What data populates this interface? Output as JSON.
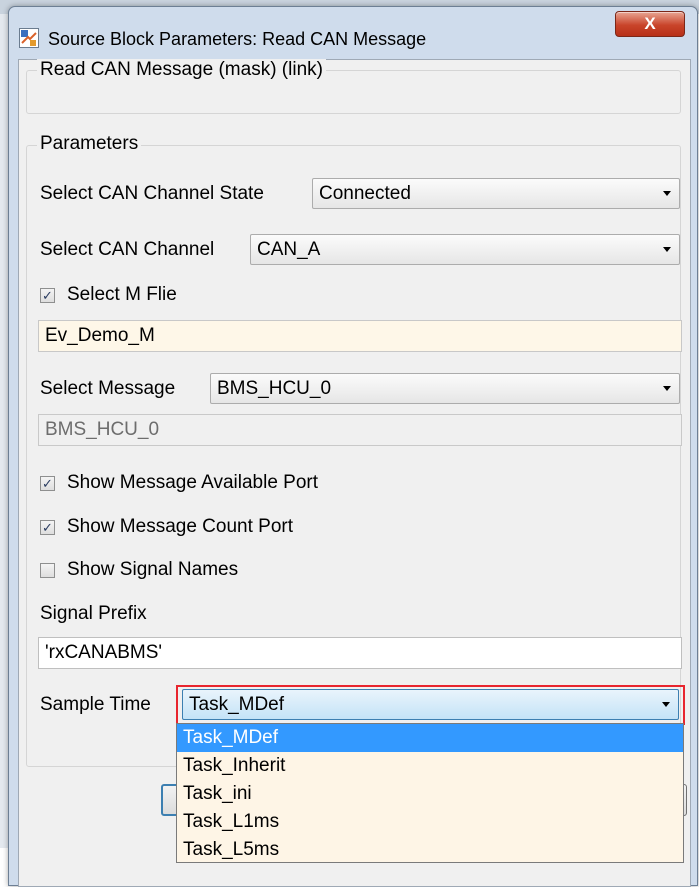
{
  "window": {
    "title": "Source Block Parameters: Read CAN Message",
    "close_label": "X"
  },
  "block_description": "Read CAN Message (mask) (link)",
  "parameters": {
    "legend": "Parameters",
    "channel_state": {
      "label": "Select CAN Channel State",
      "value": "Connected"
    },
    "channel": {
      "label": "Select CAN Channel",
      "value": "CAN_A"
    },
    "select_m_file": {
      "label": "Select M Flie",
      "checked": true
    },
    "m_file_value": "Ev_Demo_M",
    "message": {
      "label": "Select Message",
      "value": "BMS_HCU_0"
    },
    "message_display": "BMS_HCU_0",
    "show_available_port": {
      "label": "Show Message Available Port",
      "checked": true
    },
    "show_count_port": {
      "label": "Show Message Count Port",
      "checked": true
    },
    "show_signal_names": {
      "label": "Show Signal Names",
      "checked": false
    },
    "signal_prefix": {
      "label": "Signal Prefix",
      "value": "'rxCANABMS'"
    },
    "sample_time": {
      "label": "Sample Time",
      "value": "Task_MDef",
      "options": [
        "Task_MDef",
        "Task_Inherit",
        "Task_ini",
        "Task_L1ms",
        "Task_L5ms"
      ]
    }
  },
  "check_glyph": "✓",
  "colors": {
    "highlight": "#e8252e",
    "selected_option": "#3399ff"
  }
}
